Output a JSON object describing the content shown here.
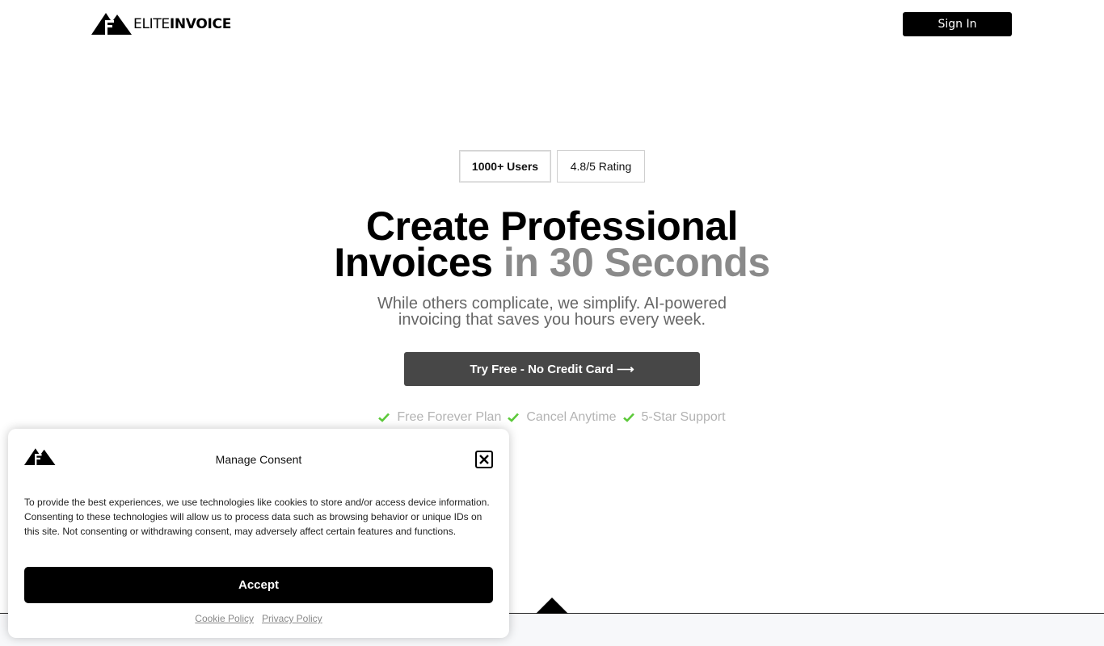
{
  "header": {
    "logo_light": "ELITE",
    "logo_bold": "INVOICE",
    "signin_label": "Sign In"
  },
  "badges": [
    "1000+ Users",
    "4.8/5 Rating"
  ],
  "hero": {
    "headline_line1": "Create Professional",
    "headline_line2_dark": "Invoices",
    "headline_line2_grey": "in 30 Seconds",
    "subhead_line1": "While others complicate, we simplify. AI-powered",
    "subhead_line2": "invoicing that saves you hours every week.",
    "cta_label": "Try Free - No Credit Card ⟶"
  },
  "features": [
    "Free Forever Plan",
    "Cancel Anytime",
    "5-Star Support"
  ],
  "consent": {
    "title": "Manage Consent",
    "body": "To provide the best experiences, we use technologies like cookies to store and/or access device information. Consenting to these technologies will allow us to process data such as browsing behavior or unique IDs on this site. Not consenting or withdrawing consent, may adversely affect certain features and functions.",
    "accept_label": "Accept",
    "cookie_policy": "Cookie Policy",
    "privacy_policy": "Privacy Policy"
  },
  "colors": {
    "accent_grey": "#8a8a8a",
    "cta_bg": "#474747",
    "check_green": "#5cc93a"
  }
}
